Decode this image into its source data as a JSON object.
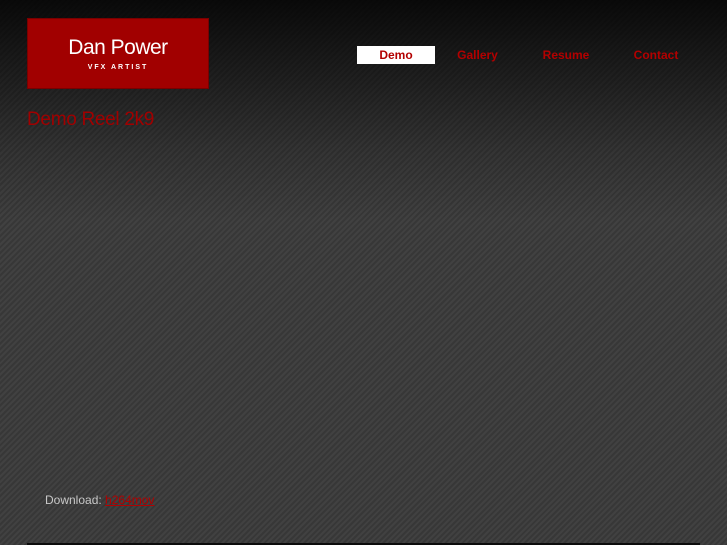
{
  "logo": {
    "name": "Dan Power",
    "tagline": "VFX ARTIST",
    "color": "#a10000"
  },
  "nav": {
    "items": [
      {
        "label": "Demo",
        "active": true
      },
      {
        "label": "Gallery",
        "active": false
      },
      {
        "label": "Resume",
        "active": false
      },
      {
        "label": "Contact",
        "active": false
      }
    ],
    "link_color": "#b30000"
  },
  "main": {
    "title": "Demo Reel 2k9",
    "download_label": "Download:",
    "download_link": "h264mov"
  }
}
